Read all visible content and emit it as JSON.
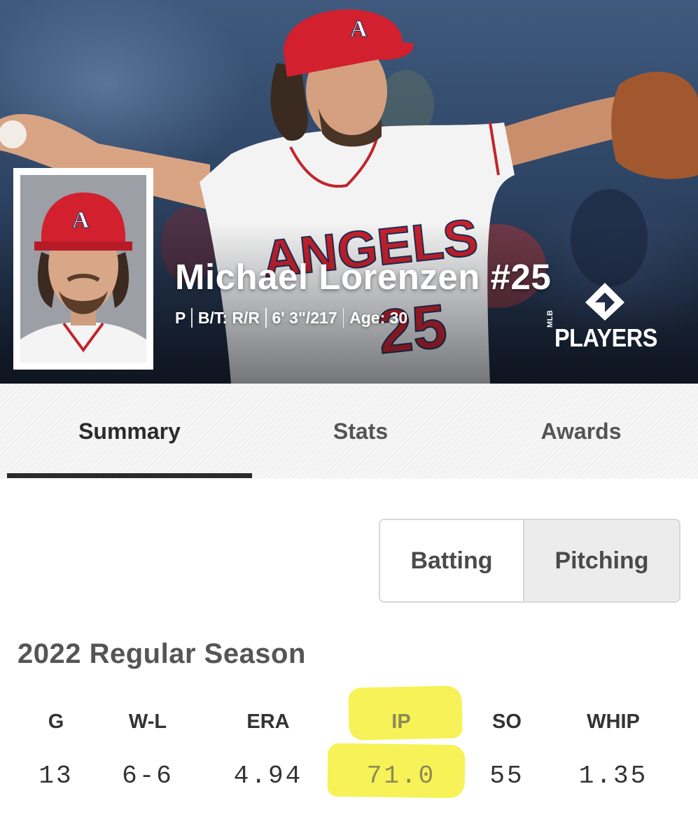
{
  "player": {
    "name": "Michael Lorenzen #25",
    "position": "P",
    "bats_throws": "B/T: R/R",
    "height_weight": "6' 3\"/217",
    "age": "Age: 30",
    "jersey_text": "ANGELS",
    "jersey_number": "25"
  },
  "brand": {
    "logo_small": "MLB",
    "logo_word": "PLAYERS"
  },
  "tabs": [
    {
      "label": "Summary",
      "active": true
    },
    {
      "label": "Stats",
      "active": false
    },
    {
      "label": "Awards",
      "active": false
    }
  ],
  "toggle": {
    "batting": "Batting",
    "pitching": "Pitching",
    "selected": "Pitching"
  },
  "season": {
    "title": "2022 Regular Season",
    "headers": [
      "G",
      "W-L",
      "ERA",
      "IP",
      "SO",
      "WHIP"
    ],
    "values": [
      "13",
      "6-6",
      "4.94",
      "71.0",
      "55",
      "1.35"
    ],
    "highlighted": "IP"
  },
  "colors": {
    "angels_red": "#d2202f",
    "highlight": "#f6f257",
    "text_dark": "#2b2b2b"
  }
}
